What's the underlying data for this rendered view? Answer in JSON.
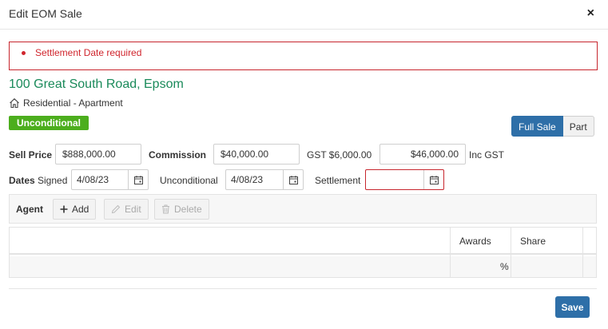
{
  "dialog": {
    "title": "Edit EOM Sale",
    "close_label": "×"
  },
  "alert": {
    "messages": [
      "Settlement Date required"
    ]
  },
  "property": {
    "address": "100 Great South Road, Epsom",
    "type": "Residential - Apartment",
    "status_badge": "Unconditional",
    "icon": "home-icon"
  },
  "sale_type": {
    "options": [
      "Full Sale",
      "Part"
    ],
    "selected": "Full Sale"
  },
  "pricing": {
    "sell_price_label": "Sell Price",
    "sell_price": "$888,000.00",
    "commission_label": "Commission",
    "commission": "$40,000.00",
    "gst_label": "GST $6,000.00",
    "inc_gst_value": "$46,000.00",
    "inc_gst_label": "Inc GST"
  },
  "dates": {
    "label": "Dates",
    "signed_label": "Signed",
    "signed_value": "4/08/23",
    "unconditional_label": "Unconditional",
    "unconditional_value": "4/08/23",
    "settlement_label": "Settlement",
    "settlement_value": ""
  },
  "agent_toolbar": {
    "label": "Agent",
    "add_label": "Add",
    "edit_label": "Edit",
    "delete_label": "Delete"
  },
  "agent_table": {
    "columns": [
      "",
      "Awards",
      "Share"
    ],
    "rows": [
      [
        "",
        "%",
        ""
      ]
    ]
  },
  "footer": {
    "save_label": "Save"
  },
  "colors": {
    "accent": "#2e6fa8",
    "error": "#d0262e",
    "address": "#1a8a5a",
    "badge": "#4cae1d"
  }
}
